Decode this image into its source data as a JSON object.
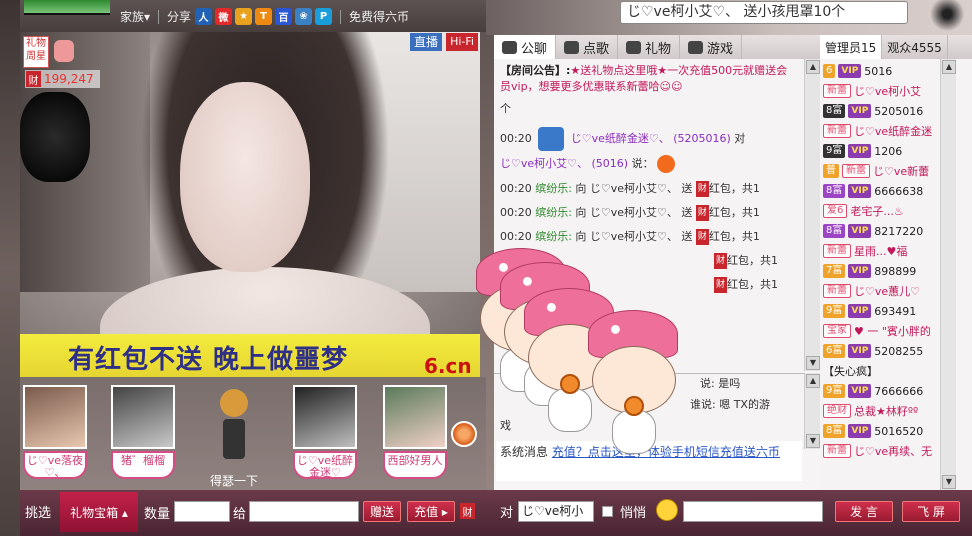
{
  "topbar": {
    "nav": [
      {
        "label": "家族▾",
        "icon": "dropdown"
      },
      {
        "label": "分享",
        "icon": null
      }
    ],
    "share_icons": [
      {
        "name": "renren-icon",
        "glyph": "人",
        "color": "#2162b5"
      },
      {
        "name": "weibo-icon",
        "glyph": "微",
        "color": "#e32a2a"
      },
      {
        "name": "star-icon",
        "glyph": "★",
        "color": "#e8a21e"
      },
      {
        "name": "tqq-icon",
        "glyph": "T",
        "color": "#ee8a12"
      },
      {
        "name": "baidu-icon",
        "glyph": "百",
        "color": "#2a55d3"
      },
      {
        "name": "kaixin-icon",
        "glyph": "❀",
        "color": "#3b82c4"
      },
      {
        "name": "qzone-icon",
        "glyph": "P",
        "color": "#1a9ddb"
      }
    ],
    "free_coins": "免费得六币"
  },
  "video": {
    "live_badge": "直播",
    "hifi_badge": "Hi-Fi",
    "gift_week": "礼物周星",
    "wealth_icon": "财",
    "wealth_value": "199,247",
    "banner_text": "有红包不送  晚上做噩梦",
    "site_logo": "6.cn"
  },
  "anchors": [
    {
      "name": "じ♡ve落夜♡、"
    },
    {
      "name": "猪゛榴榴"
    },
    {
      "name": "じ♡ve纸醉金迷♡"
    },
    {
      "name": "西部好男人"
    }
  ],
  "center_figure_label": "得瑟一下",
  "giftbar": {
    "pick_label": "挑选",
    "gift_box": "礼物宝箱 ▴",
    "quantity_label": "数量",
    "to_label": "给",
    "give_button": "赠送",
    "recharge_button": "充值 ▸",
    "wealth_icon": "财"
  },
  "right_top": {
    "announce": "じ♡ve柯小艾♡、  送小孩甩罩10个"
  },
  "chat": {
    "tabs": [
      {
        "label": "公聊",
        "active": true,
        "icon": "chat-icon"
      },
      {
        "label": "点歌",
        "active": false,
        "icon": "mic-icon"
      },
      {
        "label": "礼物",
        "active": false,
        "icon": "gift-icon"
      },
      {
        "label": "游戏",
        "active": false,
        "icon": "gamepad-icon"
      }
    ],
    "notice_label": "【房间公告】:",
    "notice_text": "★送礼物点这里哦★一次充值500元就赠送会员vip，想要更多优惠联系新蕾哈☺☺",
    "notice_tail": "个",
    "messages": [
      {
        "time": "00:20",
        "from": "じ♡ve纸醉金迷♡、",
        "id": "(5205016)",
        "verb": "对"
      },
      {
        "time": "",
        "from": "じ♡ve柯小艾♡、",
        "id": "(5016)",
        "verb": "说："
      },
      {
        "time": "00:20",
        "from": "缤纷乐:",
        "to": "向 じ♡ve柯小艾♡、 送",
        "item": "红包，共1"
      },
      {
        "time": "00:20",
        "from": "缤纷乐:",
        "to": "向 じ♡ve柯小艾♡、 送",
        "item": "红包，共1"
      },
      {
        "time": "00:20",
        "from": "缤纷乐:",
        "to": "向 じ♡ve柯小艾♡、 送",
        "item": "红包，共1"
      },
      {
        "time": "",
        "from": "",
        "to": "",
        "item": "红包，共1"
      },
      {
        "time": "",
        "from": "",
        "to": "",
        "item": "红包，共1"
      }
    ],
    "lower_lines": [
      "说: 是吗",
      "谁说: 嗯    TX的游",
      "戏"
    ],
    "system_prefix": "系统消息",
    "system_link": "充值？点击这里，体验手机短信充值送六币"
  },
  "userlist": {
    "tabs": [
      {
        "label": "管理员15",
        "active": true
      },
      {
        "label": "观众4555",
        "active": false
      }
    ],
    "rows": [
      {
        "lvl": "6",
        "lvl_color": "orange",
        "vip": true,
        "name": "5016",
        "tag": ""
      },
      {
        "lvl": "",
        "vip": false,
        "tag": "新蕾",
        "name": "じ♡ve柯小艾"
      },
      {
        "lvl": "8富",
        "lvl_color": "black",
        "vip": true,
        "name": "5205016",
        "tag": ""
      },
      {
        "lvl": "",
        "vip": false,
        "tag": "新蕾",
        "name": "じ♡ve纸醉金迷"
      },
      {
        "lvl": "9富",
        "lvl_color": "black",
        "vip": true,
        "name": "1206",
        "tag": ""
      },
      {
        "lvl": "普",
        "lvl_color": "orange",
        "vip": false,
        "tag": "新蕾",
        "name": "じ♡ve新蕾"
      },
      {
        "lvl": "8富",
        "lvl_color": "purple",
        "vip": true,
        "name": "6666638",
        "tag": ""
      },
      {
        "lvl": "",
        "vip": false,
        "tag": "爱6",
        "name": "老宅子...♨"
      },
      {
        "lvl": "8富",
        "lvl_color": "purple",
        "vip": true,
        "name": "8217220",
        "tag": ""
      },
      {
        "lvl": "",
        "vip": false,
        "tag": "新蕾",
        "name": "星雨...♥福"
      },
      {
        "lvl": "7富",
        "lvl_color": "orange",
        "vip": true,
        "name": "898899",
        "tag": ""
      },
      {
        "lvl": "",
        "vip": false,
        "tag": "新蕾",
        "name": "じ♡ve蕙儿♡"
      },
      {
        "lvl": "9富",
        "lvl_color": "orange",
        "vip": true,
        "name": "693491",
        "tag": ""
      },
      {
        "lvl": "",
        "vip": false,
        "tag": "宝家",
        "name": "♥ 一 \"賓小胖的"
      },
      {
        "lvl": "6富",
        "lvl_color": "orange",
        "vip": true,
        "name": "5208255",
        "tag": ""
      },
      {
        "lvl": "",
        "vip": false,
        "tag": "",
        "name": "【失心疯】"
      },
      {
        "lvl": "9富",
        "lvl_color": "orange",
        "vip": true,
        "name": "7666666",
        "tag": ""
      },
      {
        "lvl": "",
        "vip": false,
        "tag": "绝财",
        "name": "总裁★林籽ºº"
      },
      {
        "lvl": "8富",
        "lvl_color": "orange",
        "vip": true,
        "name": "5016520",
        "tag": ""
      },
      {
        "lvl": "",
        "vip": false,
        "tag": "新蕾",
        "name": "じ♡ve再续、无"
      }
    ]
  },
  "inputbar": {
    "to_label": "对",
    "target_value": "じ♡ve柯小",
    "whisper_label": "悄悄",
    "send_button": "发 言",
    "fly_button": "飞 屏"
  }
}
